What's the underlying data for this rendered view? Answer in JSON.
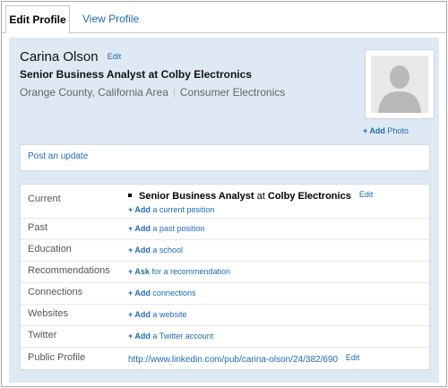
{
  "tabs": {
    "edit_profile": "Edit Profile",
    "view_profile": "View Profile"
  },
  "profile": {
    "name": "Carina Olson",
    "edit": "Edit",
    "headline": "Senior Business Analyst at Colby Electronics",
    "location": "Orange County, California Area",
    "industry": "Consumer Electronics",
    "add_photo_plus": "+ Add",
    "add_photo_rest": " Photo"
  },
  "update": {
    "label": "Post an update"
  },
  "details": {
    "current_label": "Current",
    "current_title": "Senior Business Analyst",
    "current_at": " at ",
    "current_company": "Colby Electronics",
    "current_edit": "Edit",
    "current_add_plus": "+ Add",
    "current_add_rest": " a current position",
    "past_label": "Past",
    "past_add_plus": "+ Add",
    "past_add_rest": " a past position",
    "education_label": "Education",
    "education_add_plus": "+ Add",
    "education_add_rest": " a school",
    "recommendations_label": "Recommendations",
    "recommendations_add_plus": "+ Ask",
    "recommendations_add_rest": " for a recommendation",
    "connections_label": "Connections",
    "connections_add_plus": "+ Add",
    "connections_add_rest": " connections",
    "websites_label": "Websites",
    "websites_add_plus": "+ Add",
    "websites_add_rest": " a website",
    "twitter_label": "Twitter",
    "twitter_add_plus": "+ Add",
    "twitter_add_rest": " a Twitter account",
    "public_label": "Public Profile",
    "public_url": "http://www.linkedin.com/pub/carina-olson/24/382/690",
    "public_edit": "Edit"
  },
  "icons": {
    "photo": "person-silhouette-icon",
    "bullet": "bullet-icon"
  },
  "colors": {
    "link": "#1f6ab0",
    "panel": "#dfe9f3",
    "border": "#cfdbe6"
  }
}
